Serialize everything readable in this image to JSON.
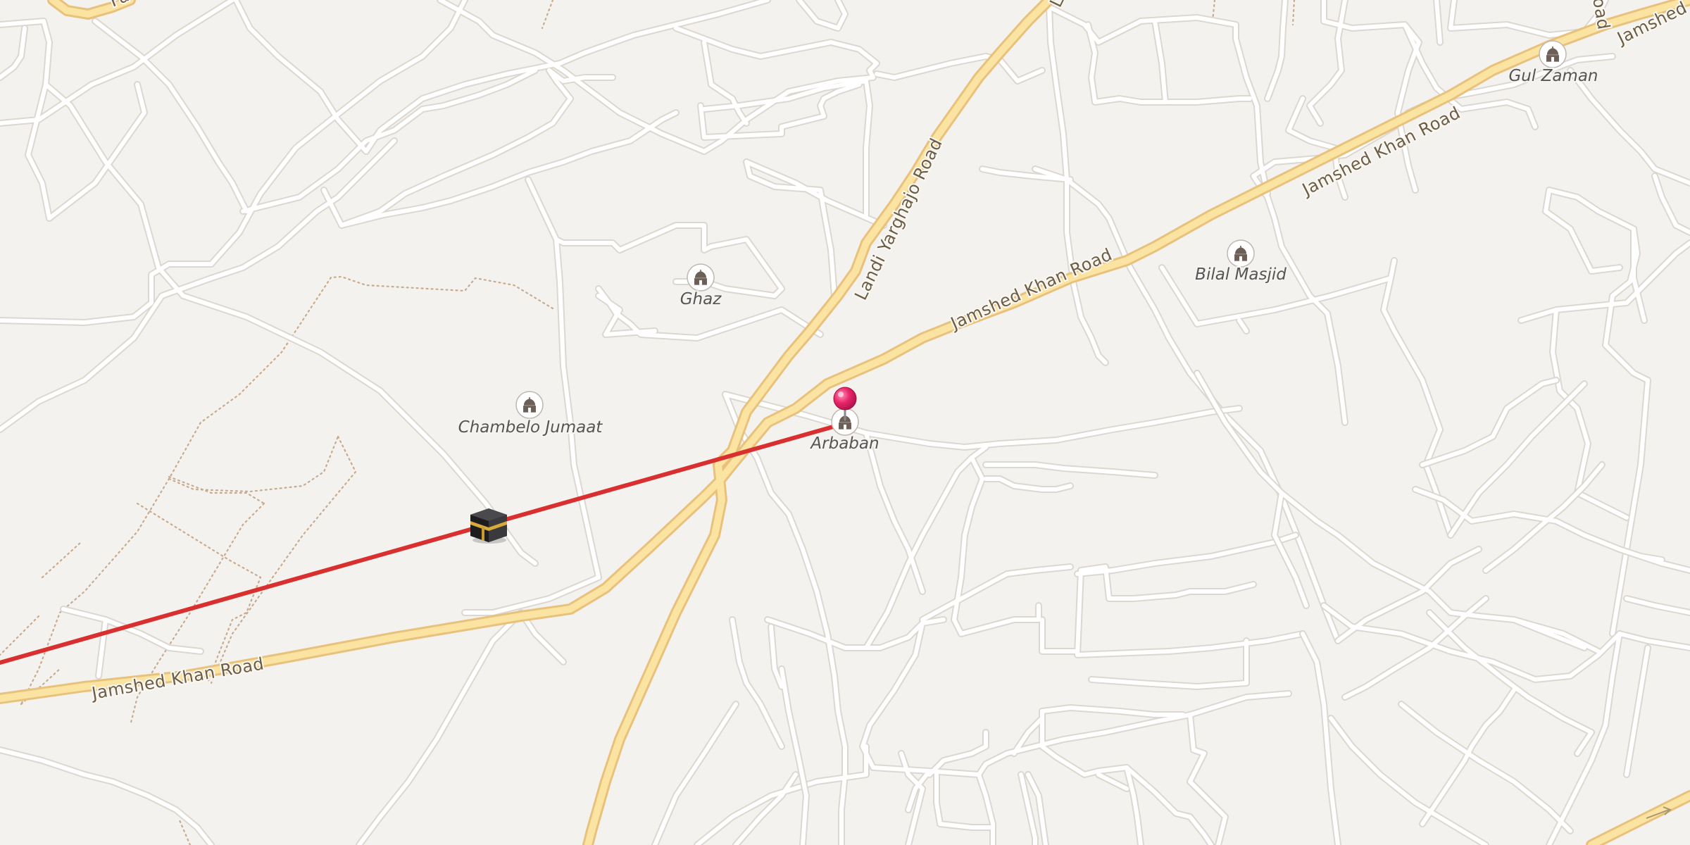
{
  "map": {
    "roads": {
      "jamshed_khan_road_sw": "Jamshed Khan Road",
      "jamshed_khan_road_center": "Jamshed Khan Road",
      "jamshed_khan_road_ne": "Jamshed Khan Road",
      "jamshed_khan_road_ne_edge": "Jamshed",
      "landi_yarghajo_road": "Landi Yarghajo Road",
      "top_road_fragment": "La",
      "top_left_fragment": "Fa",
      "top_right_fragment": "oad"
    },
    "pois": {
      "ghaz": "Ghaz",
      "chambelo_jumaat": "Chambelo Jumaat",
      "arbaban": "Arbaban",
      "bilal_masjid": "Bilal Masjid",
      "gul_zaman": "Gul Zaman"
    },
    "poi_icon": "mosque-icon",
    "qibla_marker_icon": "kaaba-icon",
    "location_pin_icon": "map-pin-icon",
    "colors": {
      "background": "#f4f2ef",
      "minor_road": "#ffffff",
      "major_road": "#fbe3a2",
      "major_road_casing": "#e8c27c",
      "qibla_line": "#d9302f",
      "pin": "#e8256b"
    }
  }
}
